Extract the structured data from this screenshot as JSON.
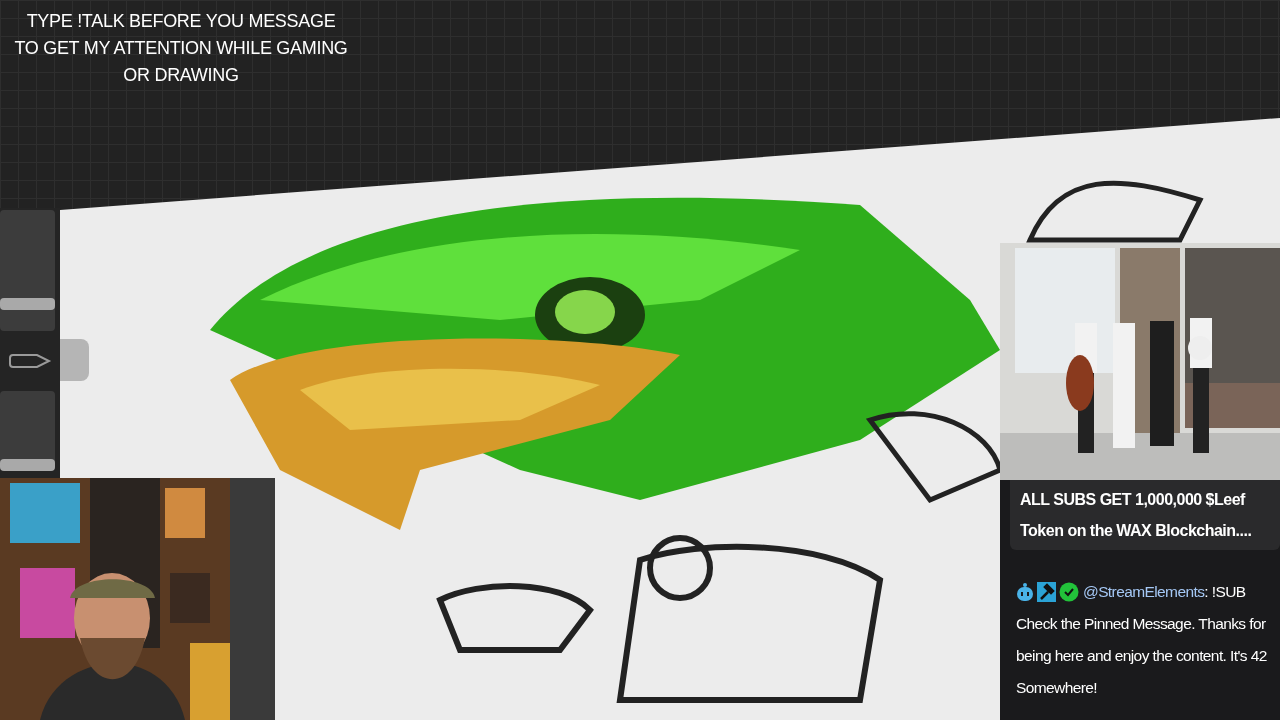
{
  "notice": {
    "lines": [
      "TYPE !TALK BEFORE YOU MESSAGE",
      "TO GET MY ATTENTION WHILE GAMING",
      "OR DRAWING"
    ]
  },
  "toolbar": {
    "brush_size": {
      "level": 0.22
    },
    "brush_opacity": {
      "level": 0.06
    }
  },
  "chat": {
    "pinned": "ALL SUBS GET 1,000,000 $Leef Token on the WAX Blockchain....",
    "messages": [
      {
        "user": "@StreamElements",
        "separator": ":",
        "first_line": "!SUB",
        "body": "Check the Pinned Message. Thanks for being here and enjoy the content. It's 42 Somewhere!"
      }
    ]
  }
}
